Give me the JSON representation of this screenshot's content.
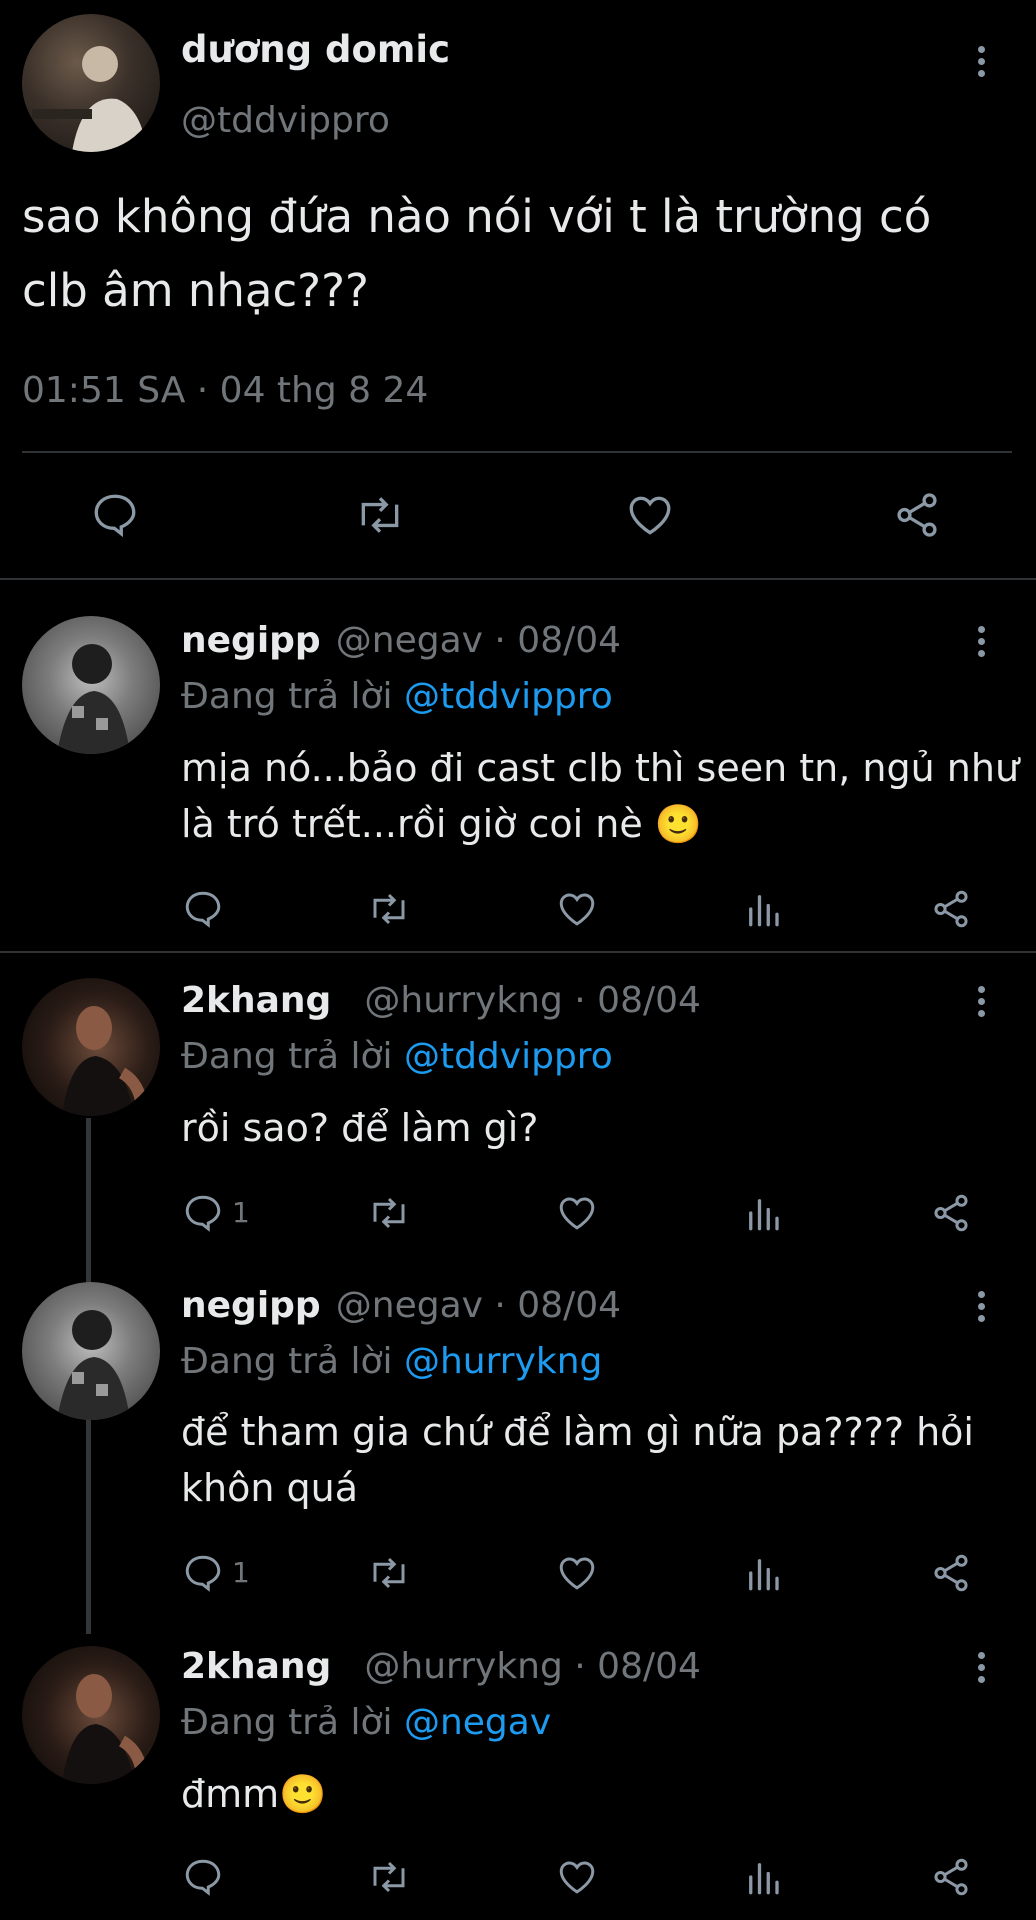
{
  "tweet": {
    "author_name": "dương domic",
    "author_handle": "@tddvippro",
    "text_line1": "sao không đứa nào nói với t là trường có",
    "text_line2": "clb âm nhạc???",
    "timestamp": "01:51 SA · 04 thg 8 24"
  },
  "replies": [
    {
      "name": "negipp",
      "meta": "@negav · 08/04",
      "replying_label": "Đang trả lời ",
      "replying_to": "@tddvippro",
      "text_line1": "mịa nó...bảo đi cast clb thì seen tn, ngủ như",
      "text_line2": "là tró trết...rồi giờ coi nè 🙂",
      "reply_count": ""
    },
    {
      "name": "2khang",
      "meta": "@hurrykng · 08/04",
      "replying_label": "Đang trả lời ",
      "replying_to": "@tddvippro",
      "text_line1": "rồi sao? để làm gì?",
      "text_line2": "",
      "reply_count": "1"
    },
    {
      "name": "negipp",
      "meta": "@negav · 08/04",
      "replying_label": "Đang trả lời ",
      "replying_to": "@hurrykng",
      "text_line1": "để tham gia chứ để làm gì nữa pa???? hỏi",
      "text_line2": "khôn quá",
      "reply_count": "1"
    },
    {
      "name": "2khang",
      "meta": "@hurrykng · 08/04",
      "replying_label": "Đang trả lời ",
      "replying_to": "@negav",
      "text_line1": "đmm🙂",
      "text_line2": "",
      "reply_count": ""
    }
  ],
  "icons": {
    "reply": "reply-icon",
    "retweet": "retweet-icon",
    "like": "like-icon",
    "views": "views-icon",
    "share": "share-icon",
    "more": "more-icon"
  },
  "colors": {
    "background": "#000000",
    "text": "#e7e9ea",
    "muted": "#71767b",
    "accent": "#1d9bf0"
  }
}
